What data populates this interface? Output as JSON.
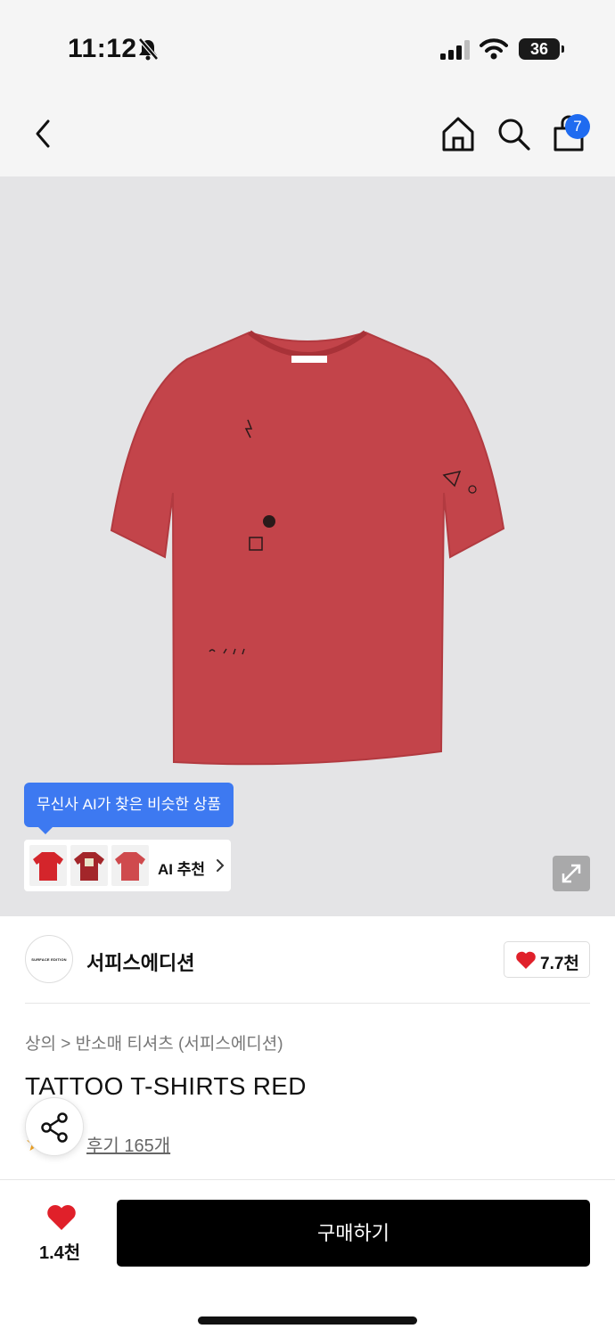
{
  "status": {
    "time": "11:12",
    "battery": "36"
  },
  "nav": {
    "cart_count": "7"
  },
  "image": {
    "ai_tooltip": "무신사 AI가 찾은 비슷한 상품",
    "ai_label": "AI 추천",
    "garment_color": "#c3444a"
  },
  "brand": {
    "logo_text": "SURFACE EDITION",
    "name": "서피스에디션",
    "likes": "7.7천"
  },
  "product": {
    "breadcrumb": "상의 > 반소매 티셔츠 (서피스에디션)",
    "title": "TATTOO T-SHIRTS RED",
    "review": "후기 165개"
  },
  "bottom": {
    "likes": "1.4천",
    "buy_label": "구매하기"
  },
  "colors": {
    "accent": "#1f6bf0",
    "tooltip": "#3d79f1",
    "heart": "#e0202a"
  }
}
